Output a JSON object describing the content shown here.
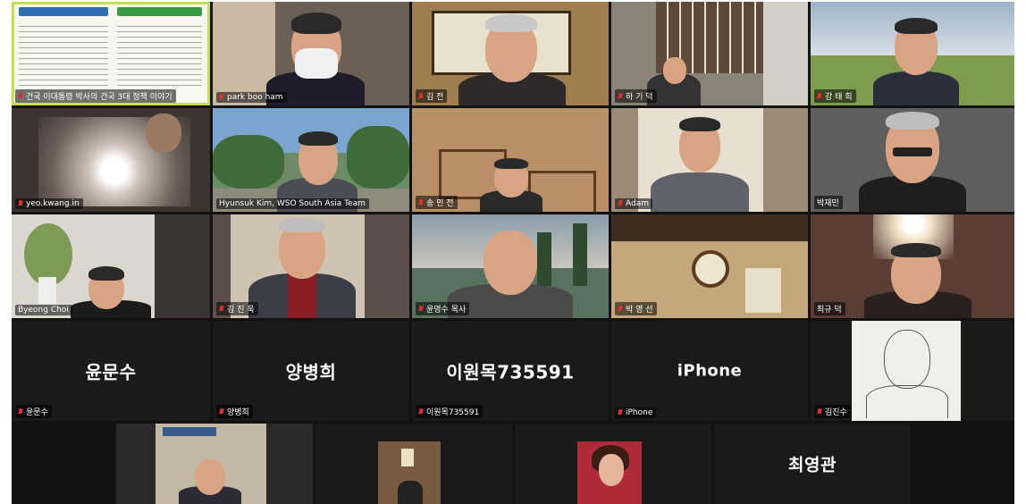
{
  "meeting": {
    "tiles": [
      {
        "id": "t1",
        "label": "건국 이대통령 박사의 건국 3대 정책 이야기",
        "big": "",
        "bg": "#f7f7f0"
      },
      {
        "id": "t2",
        "label": "park boo ham",
        "big": "",
        "bg": "#6c5f55"
      },
      {
        "id": "t3",
        "label": "김 전",
        "big": "",
        "bg": "#a07d4f"
      },
      {
        "id": "t4",
        "label": "하 기 덕",
        "big": "",
        "bg": "#8a8478"
      },
      {
        "id": "t5",
        "label": "강 태 희",
        "big": "",
        "bg": "#8fa2b4"
      },
      {
        "id": "t6",
        "label": "yeo.kwang.in",
        "big": "",
        "bg": "#3d3430"
      },
      {
        "id": "t7",
        "label": "Hyunsuk Kim, WSO South Asia Team",
        "big": "",
        "bg": "#6d8b67"
      },
      {
        "id": "t8",
        "label": "송 민 전",
        "big": "",
        "bg": "#b98f68"
      },
      {
        "id": "t9",
        "label": "Adam",
        "big": "",
        "bg": "#9a8a76"
      },
      {
        "id": "t10",
        "label": "박재민",
        "big": "",
        "bg": "#5e5e5e"
      },
      {
        "id": "t11",
        "label": "Byeong Choi",
        "big": "",
        "bg": "#d9d7d0"
      },
      {
        "id": "t12",
        "label": "김 진 욱",
        "big": "",
        "bg": "#5a5049"
      },
      {
        "id": "t13",
        "label": "윤영수 목사",
        "big": "",
        "bg": "#587160"
      },
      {
        "id": "t14",
        "label": "박 영 선",
        "big": "",
        "bg": "#c4a879"
      },
      {
        "id": "t15",
        "label": "최규 덕",
        "big": "",
        "bg": "#5a3e36"
      },
      {
        "id": "t16",
        "label": "윤문수",
        "big": "윤문수",
        "bg": "#1a1a1a"
      },
      {
        "id": "t17",
        "label": "양병희",
        "big": "양병희",
        "bg": "#1a1a1a"
      },
      {
        "id": "t18",
        "label": "이원목735591",
        "big": "이원목735591",
        "bg": "#1a1a1a"
      },
      {
        "id": "t19",
        "label": "iPhone",
        "big": "iPhone",
        "bg": "#1a1a1a"
      },
      {
        "id": "t20",
        "label": "김진수",
        "big": "",
        "bg": "#1a1a1a"
      },
      {
        "id": "t21",
        "label": "",
        "big": "",
        "bg": "#c3b8a6"
      },
      {
        "id": "t22",
        "label": "",
        "big": "",
        "bg": "#7a5a3e"
      },
      {
        "id": "t23",
        "label": "",
        "big": "",
        "bg": "#b02a39"
      },
      {
        "id": "t24",
        "label": "최영관",
        "big": "최영관",
        "bg": "#1a1a1a"
      }
    ]
  },
  "colors": {
    "active_speaker": "#c5e04b",
    "muted_mic": "#e0302c",
    "background": "#121212"
  }
}
